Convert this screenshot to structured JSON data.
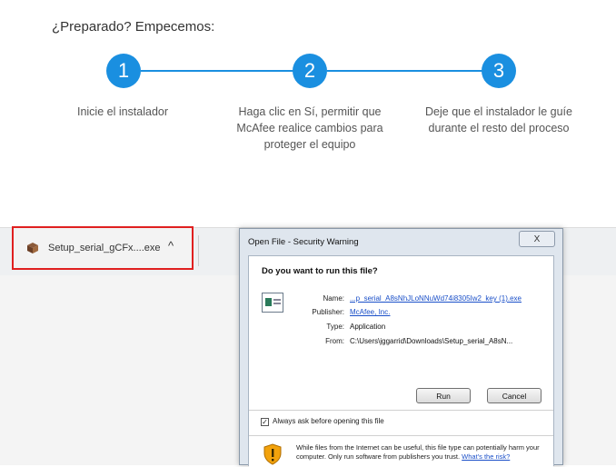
{
  "page": {
    "heading": "¿Preparado? Empecemos:"
  },
  "steps": [
    {
      "number": "1",
      "text": "Inicie el instalador"
    },
    {
      "number": "2",
      "text": "Haga clic en Sí, permitir que McAfee realice cambios para proteger el equipo"
    },
    {
      "number": "3",
      "text": "Deje que el instalador le guíe durante el resto del proceso"
    }
  ],
  "colors": {
    "accent": "#1a8fe0",
    "highlight_border": "#e02020"
  },
  "download_bar": {
    "file_name": "Setup_serial_gCFx....exe",
    "caret": "^",
    "icon": "package-icon"
  },
  "dialog": {
    "title": "Open File - Security Warning",
    "close": "X",
    "question": "Do you want to run this file?",
    "fields": {
      "name_label": "Name:",
      "name_value": "...p_serial_A8sNhJLoNNuWd74i8305Iw2_key (1).exe",
      "publisher_label": "Publisher:",
      "publisher_value": "McAfee, Inc.",
      "type_label": "Type:",
      "type_value": "Application",
      "from_label": "From:",
      "from_value": "C:\\Users\\jggarrid\\Downloads\\Setup_serial_A8sN..."
    },
    "run_button": "Run",
    "cancel_button": "Cancel",
    "always_ask_label": "Always ask before opening this file",
    "always_ask_checked": true,
    "warning_text": "While files from the Internet can be useful, this file type can potentially harm your computer. Only run software from publishers you trust.",
    "risk_link": "What's the risk?"
  }
}
